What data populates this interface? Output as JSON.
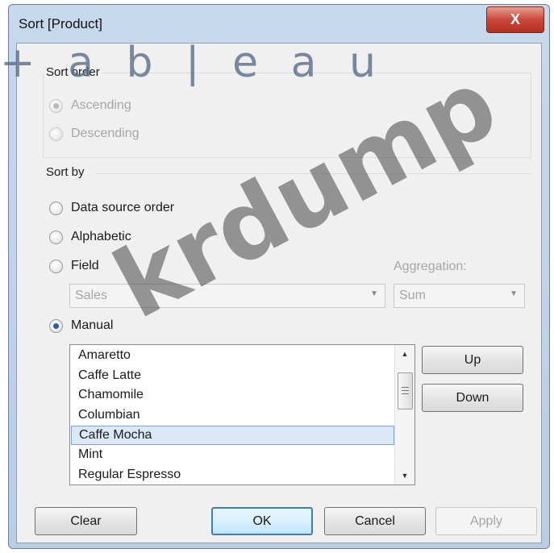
{
  "window": {
    "title": "Sort [Product]",
    "close_label": "X"
  },
  "sort_order": {
    "label": "Sort order",
    "ascending": "Ascending",
    "descending": "Descending"
  },
  "sort_by": {
    "label": "Sort by",
    "data_source_order": "Data source order",
    "alphabetic": "Alphabetic",
    "field": "Field",
    "aggregation_label": "Aggregation:",
    "field_value": "Sales",
    "aggregation_value": "Sum",
    "manual": "Manual"
  },
  "manual_list": {
    "items": [
      "Amaretto",
      "Caffe Latte",
      "Chamomile",
      "Columbian",
      "Caffe Mocha",
      "Mint",
      "Regular Espresso"
    ],
    "selected": "Caffe Mocha"
  },
  "buttons": {
    "up": "Up",
    "down": "Down",
    "clear": "Clear",
    "ok": "OK",
    "cancel": "Cancel",
    "apply": "Apply"
  },
  "overlay": {
    "logo_text": "+ a b | e a u",
    "watermark_text": "krdump"
  },
  "colors": {
    "title_bg": "#b9cde3",
    "close_red": "#c9473a",
    "selected_bg": "#dbe8f7"
  }
}
